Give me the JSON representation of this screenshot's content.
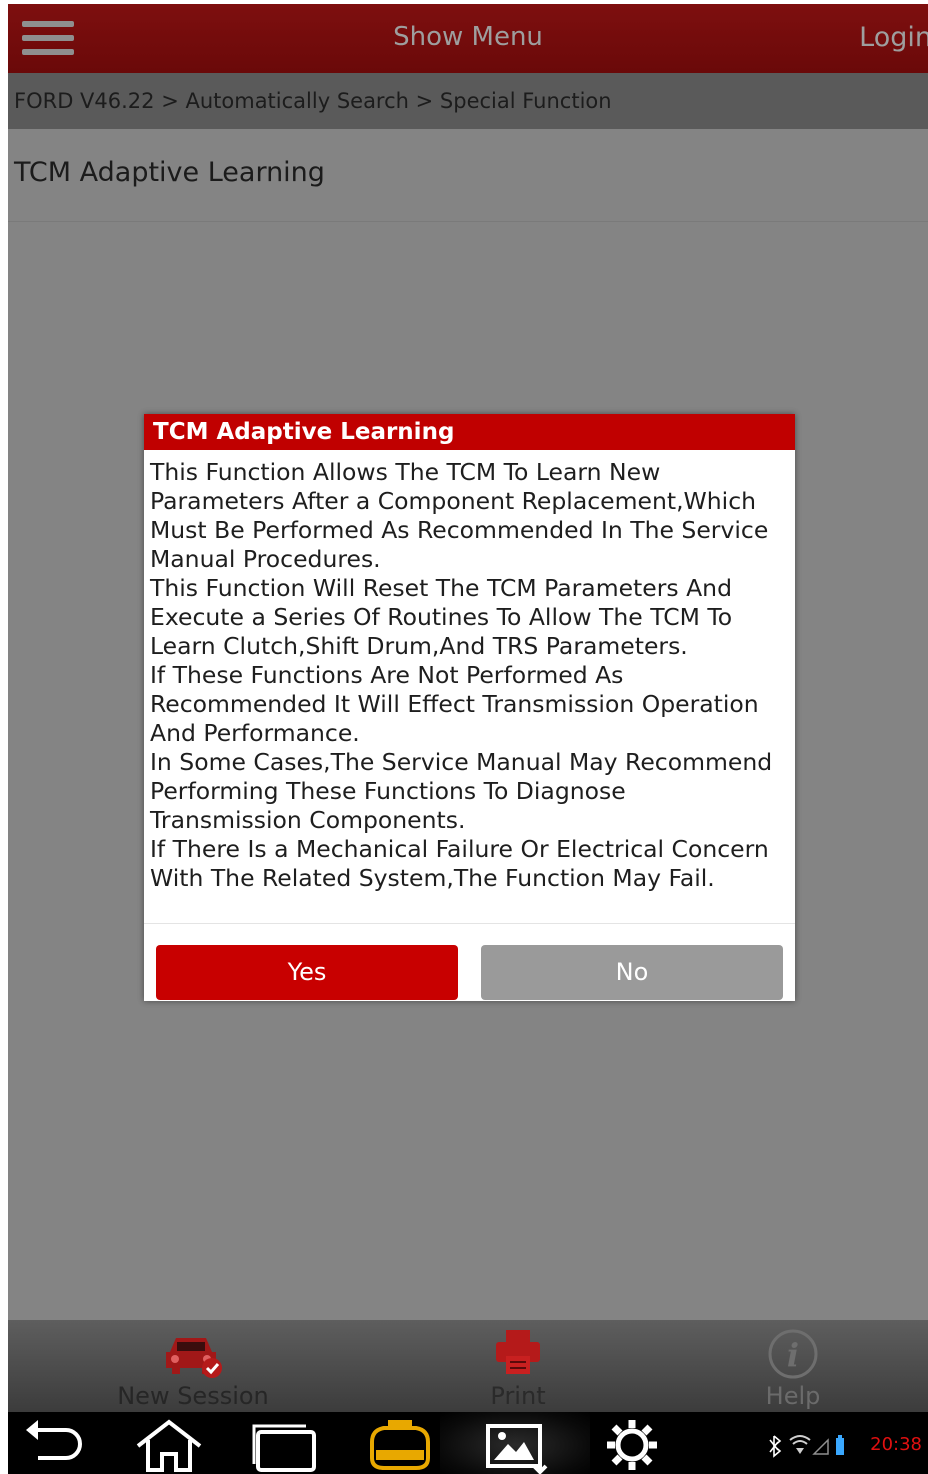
{
  "topbar": {
    "menu_icon": "hamburger-menu-icon",
    "title": "Show Menu",
    "login_label": "Login"
  },
  "breadcrumb": {
    "text": "FORD V46.22 > Automatically Search > Special Function"
  },
  "page": {
    "title": "TCM Adaptive Learning"
  },
  "dialog": {
    "title": "TCM Adaptive Learning",
    "lines": [
      "This Function Allows The TCM To Learn New",
      "Parameters After a Component Replacement,Which",
      "Must Be Performed As Recommended In The Service",
      "Manual Procedures.",
      "This Function Will Reset The TCM Parameters And",
      "Execute a Series Of Routines To Allow The TCM To",
      "Learn Clutch,Shift Drum,And TRS Parameters.",
      "If These Functions Are Not Performed As",
      "Recommended It Will Effect Transmission Operation",
      "And Performance.",
      "In Some Cases,The Service Manual May Recommend",
      "Performing These Functions To Diagnose",
      "Transmission Components.",
      "If There Is a Mechanical Failure Or Electrical Concern",
      "With The Related System,The Function May Fail."
    ],
    "yes_label": "Yes",
    "no_label": "No"
  },
  "toolbar": {
    "new_session_label": "New Session",
    "new_session_icon": "car-check-icon",
    "print_label": "Print",
    "print_icon": "printer-icon",
    "help_label": "Help",
    "help_icon": "info-icon"
  },
  "navbar": {
    "icons": [
      "back-icon",
      "home-icon",
      "recent-apps-icon",
      "maximus-app-icon",
      "screenshot-icon",
      "settings-gear-icon"
    ],
    "clock": "20:38"
  },
  "colors": {
    "topbar": "#6a0909",
    "accent_red": "#c80000",
    "overlay_gray": "#848484",
    "no_button": "#9a9a9a"
  }
}
